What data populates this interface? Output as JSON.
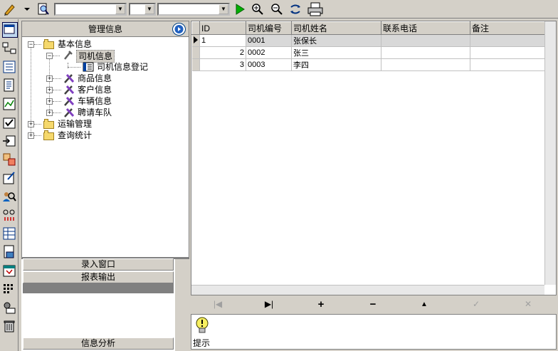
{
  "toolbar": {
    "combo1": "",
    "combo2": "",
    "combo3": ""
  },
  "tree": {
    "header": "管理信息",
    "nodes": {
      "basic": "基本信息",
      "driver_info": "司机信息",
      "driver_register": "司机信息登记",
      "goods": "商品信息",
      "customer": "客户信息",
      "vehicle": "车辆信息",
      "hire_fleet": "聘请车队",
      "transport": "运输管理",
      "query": "查询统计"
    }
  },
  "side_buttons": {
    "entry_window": "录入窗口",
    "report_output": "报表输出",
    "info_analysis": "信息分析"
  },
  "grid": {
    "columns": [
      "ID",
      "司机编号",
      "司机姓名",
      "联系电话",
      "备注"
    ],
    "rows": [
      {
        "id": "1",
        "code": "0001",
        "name": "张保长",
        "phone": "",
        "note": ""
      },
      {
        "id": "2",
        "code": "0002",
        "name": "张三",
        "phone": "",
        "note": ""
      },
      {
        "id": "3",
        "code": "0003",
        "name": "李四",
        "phone": "",
        "note": ""
      }
    ]
  },
  "navigator": {
    "first": "|◀",
    "last": "▶|",
    "insert": "+",
    "delete": "−",
    "edit": "▲",
    "post": "✓",
    "cancel": "✕"
  },
  "hint": {
    "label": "提示"
  }
}
